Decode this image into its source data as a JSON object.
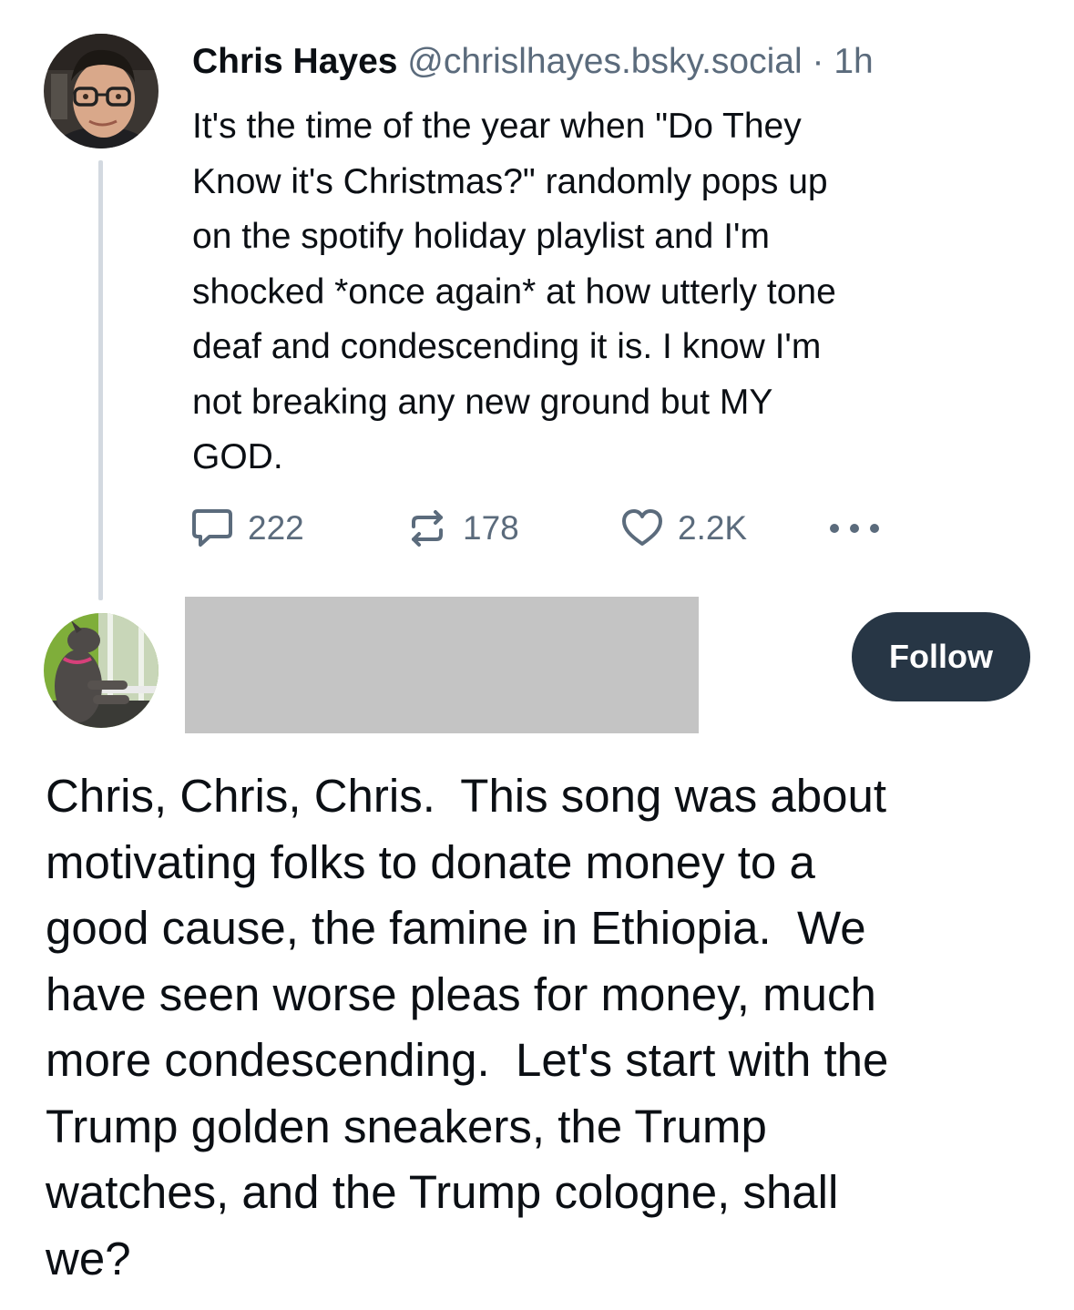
{
  "original_post": {
    "author": {
      "display_name": "Chris Hayes",
      "handle": "@chrislhayes.bsky.social",
      "avatar_icon": "man-with-glasses-avatar"
    },
    "separator": "·",
    "timestamp": "1h",
    "lines": [
      "It's the time of the year when \"Do They",
      "Know it's Christmas?\" randomly pops up",
      "on the spotify holiday playlist and I'm",
      "shocked *once again* at how utterly tone",
      "deaf and condescending it is. I know I'm",
      "not breaking any new ground but MY",
      "GOD."
    ],
    "actions": {
      "replies": "222",
      "reposts": "178",
      "likes": "2.2K",
      "reply_icon": "speech-bubble-icon",
      "repost_icon": "repost-icon",
      "like_icon": "heart-icon",
      "more_icon": "more-dots-icon"
    }
  },
  "reply_post": {
    "avatar_icon": "dog-at-window-avatar",
    "name_redacted": true,
    "follow_label": "Follow",
    "lines": [
      "Chris, Chris, Chris.  This song was about",
      "motivating folks to donate money to a",
      "good cause, the famine in Ethiopia.  We",
      "have seen worse pleas for money, much",
      "more condescending.  Let's start with the",
      "Trump golden sneakers, the Trump",
      "watches, and the Trump cologne, shall",
      "we?"
    ]
  },
  "colors": {
    "text_primary": "#0b0f14",
    "text_secondary": "#5b6b7c",
    "thread_line": "#d3d9e0",
    "follow_button_bg": "#273645",
    "follow_button_text": "#ffffff",
    "redaction": "#c4c4c4"
  }
}
